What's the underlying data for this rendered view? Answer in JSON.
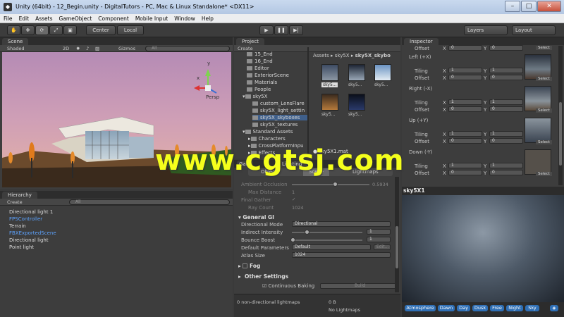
{
  "window": {
    "title": "Unity (64bit) - 12_Begin.unity - DigitalTutors - PC, Mac & Linux Standalone* <DX11>",
    "minimize": "–",
    "maximize": "□",
    "close": "✕"
  },
  "menu": [
    "File",
    "Edit",
    "Assets",
    "GameObject",
    "Component",
    "Mobile Input",
    "Window",
    "Help"
  ],
  "toolbar": {
    "center": "Center",
    "local": "Local",
    "layers": "Layers",
    "layout": "Layout"
  },
  "scene": {
    "tab": "Scene",
    "shading": "Shaded",
    "mode2d": "2D",
    "gizmos": "Gizmos",
    "search_placeholder": "All",
    "persp": "Persp",
    "axis_y": "y",
    "axis_x": "x"
  },
  "hierarchy": {
    "tab": "Hierarchy",
    "create": "Create",
    "search_placeholder": "All",
    "items": [
      {
        "label": "Directional light 1",
        "blue": false
      },
      {
        "label": "FPSController",
        "blue": true
      },
      {
        "label": "Terrain",
        "blue": false
      },
      {
        "label": "FBXExportedScene",
        "blue": true
      },
      {
        "label": "Directional light",
        "blue": false
      },
      {
        "label": "Point light",
        "blue": false
      }
    ]
  },
  "project": {
    "tab": "Project",
    "create": "Create",
    "tree": [
      "15_End",
      "16_End",
      "Editor",
      "ExteriorScene",
      "Materials",
      "People",
      "sky5X",
      "custom_LensFlare",
      "sky5X_light_settin",
      "sky5X_skyboxes",
      "sky5X_textures",
      "Standard Assets",
      "Characters",
      "CrossPlatformInpu",
      "Effects"
    ],
    "breadcrumb": [
      "Assets",
      "sky5X",
      "sky5X_skybo"
    ],
    "thumbs": [
      "sky5...",
      "sky5...",
      "sky5...",
      "sky5...",
      "sky5..."
    ],
    "selected_asset": "sky5X1.mat"
  },
  "lighting": {
    "tab": "Lighting",
    "tabs": [
      "Object",
      "Scene",
      "Lightmaps"
    ],
    "rows": [
      {
        "label": "Ambient Occlusion",
        "value": "0.5934"
      },
      {
        "label": "Max Distance",
        "value": "1"
      },
      {
        "label": "Final Gather",
        "value": "✓"
      },
      {
        "label": "Ray Count",
        "value": "1024"
      }
    ],
    "general_gi": "General GI",
    "directional_mode": {
      "label": "Directional Mode",
      "value": "Directional"
    },
    "indirect_intensity": {
      "label": "Indirect Intensity",
      "value": "1"
    },
    "bounce_boost": {
      "label": "Bounce Boost",
      "value": "1"
    },
    "default_parameters": {
      "label": "Default Parameters",
      "value": "Default",
      "button": "Edit..."
    },
    "atlas_size": {
      "label": "Atlas Size",
      "value": "1024"
    },
    "fog": "Fog",
    "other_settings": "Other Settings",
    "continuous_baking": "Continuous Baking",
    "build": "Build",
    "footer_left": "0 non-directional lightmaps",
    "footer_size": "0 B",
    "footer_status": "No Lightmaps"
  },
  "inspector": {
    "tab": "Inspector",
    "faces": [
      {
        "title": "",
        "offset_x": "0",
        "offset_y": "0"
      },
      {
        "title": "Left (+X)",
        "tiling_x": "1",
        "tiling_y": "1",
        "offset_x": "0",
        "offset_y": "0"
      },
      {
        "title": "Right (-X)",
        "tiling_x": "1",
        "tiling_y": "1",
        "offset_x": "0",
        "offset_y": "0"
      },
      {
        "title": "Up (+Y)",
        "tiling_x": "1",
        "tiling_y": "1",
        "offset_x": "0",
        "offset_y": "0"
      },
      {
        "title": "Down (-Y)",
        "tiling_x": "1",
        "tiling_y": "1",
        "offset_x": "0",
        "offset_y": "0"
      }
    ],
    "labels": {
      "offset": "Offset",
      "tiling": "Tiling",
      "x": "X",
      "y": "Y",
      "select": "Select"
    },
    "preview_title": "sky5X1",
    "preview_tags": [
      "Atmosphere",
      "Dawn",
      "Day",
      "Dusk",
      "Free",
      "Night",
      "Sky"
    ]
  },
  "watermark": "www.cgtsj.com"
}
